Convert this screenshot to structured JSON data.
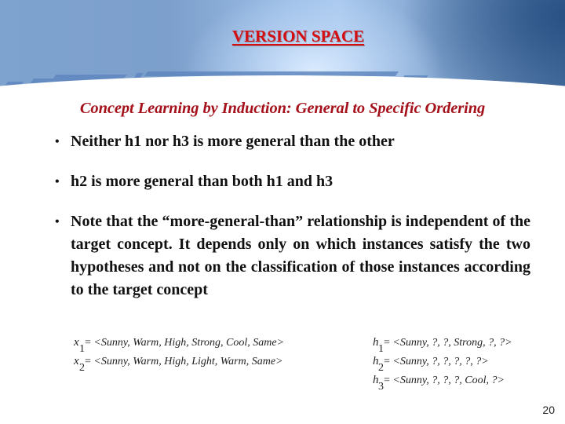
{
  "slide": {
    "title": "VERSION SPACE",
    "subtitle": "Concept Learning by Induction: General to Specific Ordering",
    "bullets": [
      {
        "text": "Neither h1 nor h3 is more general than the other"
      },
      {
        "text": "h2 is more general than both h1 and h3"
      },
      {
        "text": "Note that the “more-general-than” relationship is independent of the target concept. It depends only on which instances satisfy the two hypotheses and not on the classification of those instances according to the target concept"
      }
    ],
    "bullet_glyph": "•",
    "instances": [
      {
        "var": "x",
        "sub": "1",
        "eq": "=",
        "value": "<Sunny, Warm, High, Strong, Cool, Same>"
      },
      {
        "var": "x",
        "sub": "2",
        "eq": "=",
        "value": "<Sunny, Warm, High, Light, Warm, Same>"
      }
    ],
    "hypotheses": [
      {
        "var": "h",
        "sub": "1",
        "eq": "=",
        "value": "<Sunny, ?, ?, Strong, ?, ?>"
      },
      {
        "var": "h",
        "sub": "2",
        "eq": "=",
        "value": "<Sunny, ?, ?, ?, ?, ?>"
      },
      {
        "var": "h",
        "sub": "3",
        "eq": "=",
        "value": "<Sunny, ?, ?, ?, Cool, ?>"
      }
    ],
    "page_number": "20"
  },
  "colors": {
    "title": "#d40f12",
    "subtitle": "#a5111b",
    "body_text": "#111111",
    "header_blue": "#7fa3cf"
  }
}
